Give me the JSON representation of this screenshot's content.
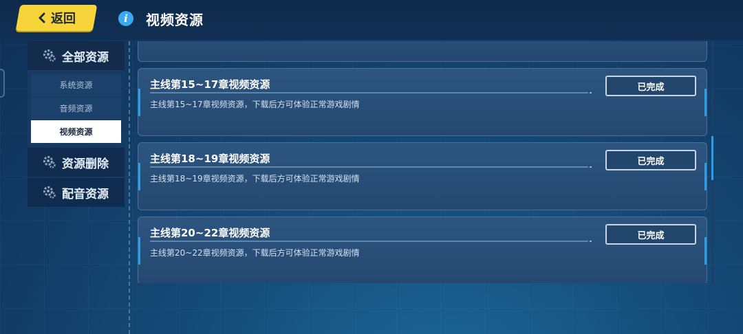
{
  "header": {
    "back_label": "返回",
    "title": "视频资源",
    "info_icon": "info-icon"
  },
  "sidebar": {
    "sections": [
      {
        "label": "全部资源",
        "icon": "gear-icon"
      },
      {
        "label": "资源删除",
        "icon": "gear-icon"
      },
      {
        "label": "配音资源",
        "icon": "gear-icon"
      }
    ],
    "sub_items": [
      {
        "label": "系统资源",
        "selected": false
      },
      {
        "label": "音频资源",
        "selected": false
      },
      {
        "label": "视频资源",
        "selected": true
      }
    ]
  },
  "resources": [
    {
      "title": "主线第15~17章视频资源",
      "desc": "主线第15~17章视频资源，下载后方可体验正常游戏剧情",
      "status": "已完成"
    },
    {
      "title": "主线第18~19章视频资源",
      "desc": "主线第18~19章视频资源，下载后方可体验正常游戏剧情",
      "status": "已完成"
    },
    {
      "title": "主线第20~22章视频资源",
      "desc": "主线第20~22章视频资源，下载后方可体验正常游戏剧情",
      "status": "已完成"
    }
  ],
  "colors": {
    "accent": "#2b9fe6",
    "back_button": "#f6d43a"
  }
}
